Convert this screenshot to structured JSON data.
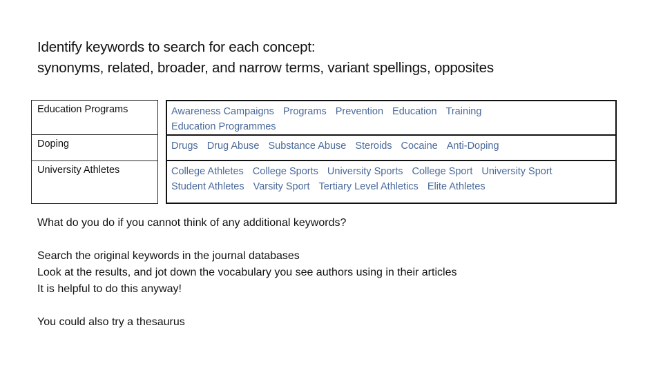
{
  "heading": {
    "line1": "Identify keywords to search for each concept:",
    "line2": "synonyms, related, broader, and narrow terms, variant spellings, opposites"
  },
  "concepts": [
    {
      "concept": "Education Programs",
      "lines": [
        [
          "Awareness Campaigns",
          "Programs",
          "Prevention",
          "Education",
          "Training"
        ],
        [
          "Education Programmes"
        ]
      ]
    },
    {
      "concept": "Doping",
      "lines": [
        [
          "Drugs",
          "Drug Abuse",
          "Substance Abuse",
          "Steroids",
          "Cocaine",
          "Anti-Doping"
        ]
      ]
    },
    {
      "concept": "University Athletes",
      "lines": [
        [
          "College Athletes",
          "College Sports",
          "University Sports",
          "College Sport",
          "University Sport"
        ],
        [
          "Student Athletes",
          "Varsity Sport",
          "Tertiary Level Athletics",
          "Elite Athletes"
        ]
      ]
    }
  ],
  "body": {
    "question": "What do you do if you cannot think of any additional keywords?",
    "tips": [
      "Search the original keywords in the journal databases",
      "Look at the results, and jot down the vocabulary you see authors using in their articles",
      "It is helpful to do this anyway!"
    ],
    "closing": "You could also try a thesaurus"
  },
  "colors": {
    "keyword_text": "#4a6a9a",
    "body_text": "#111111"
  }
}
